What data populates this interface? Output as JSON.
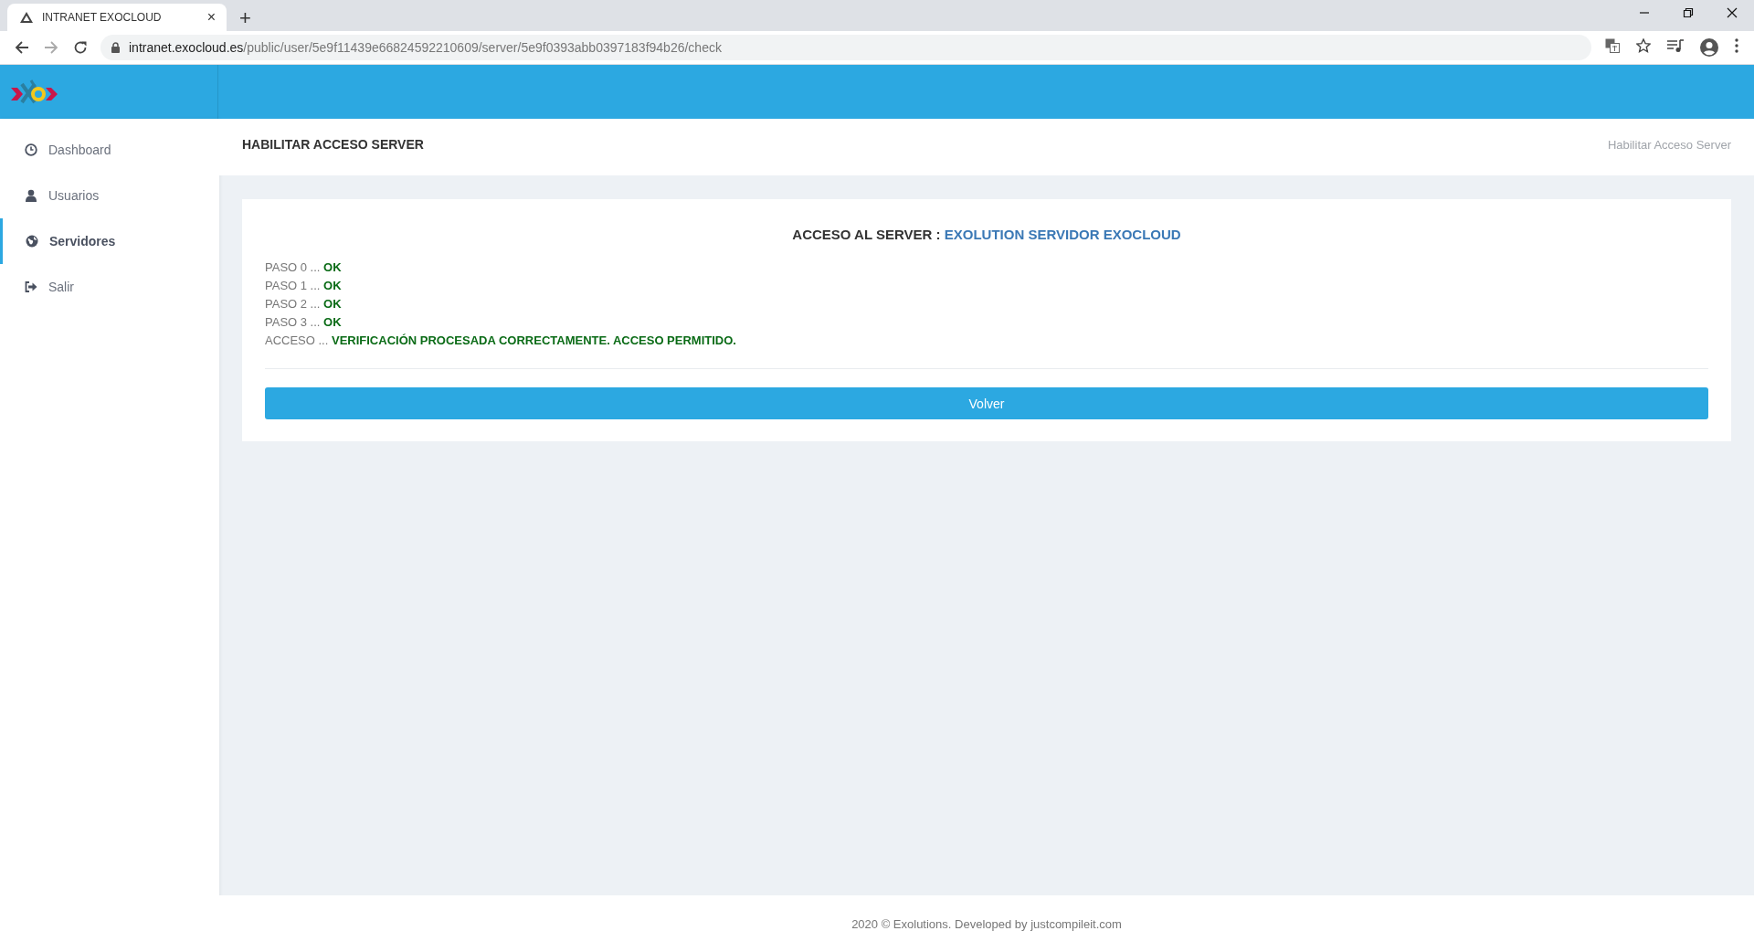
{
  "browser": {
    "tab": {
      "title": "INTRANET EXOCLOUD",
      "close": "×"
    },
    "new_tab": "+",
    "url": {
      "host": "intranet.exocloud.es",
      "path": "/public/user/5e9f11439e66824592210609/server/5e9f0393abb0397183f94b26/check"
    }
  },
  "sidebar": {
    "items": [
      {
        "label": "Dashboard",
        "selected": false
      },
      {
        "label": "Usuarios",
        "selected": false
      },
      {
        "label": "Servidores",
        "selected": true
      },
      {
        "label": "Salir",
        "selected": false
      }
    ]
  },
  "page_header": {
    "title": "HABILITAR ACCESO SERVER",
    "breadcrumb": "Habilitar Acceso Server"
  },
  "card": {
    "title_label": "ACCESO AL SERVER :",
    "server_name": "EXOLUTION SERVIDOR EXOCLOUD",
    "lines": [
      "PASO 0 ... **OK**",
      "PASO 1 ... **OK**",
      "PASO 2 ... **OK**",
      "PASO 3 ... **OK**",
      "ACCESO ... **VERIFICACIÓN PROCESADA CORRECTAMENTE. ACCESO PERMITIDO.**"
    ],
    "button": "Volver"
  },
  "footer": "2020 © Exolutions. Developed by justcompileit.com"
}
